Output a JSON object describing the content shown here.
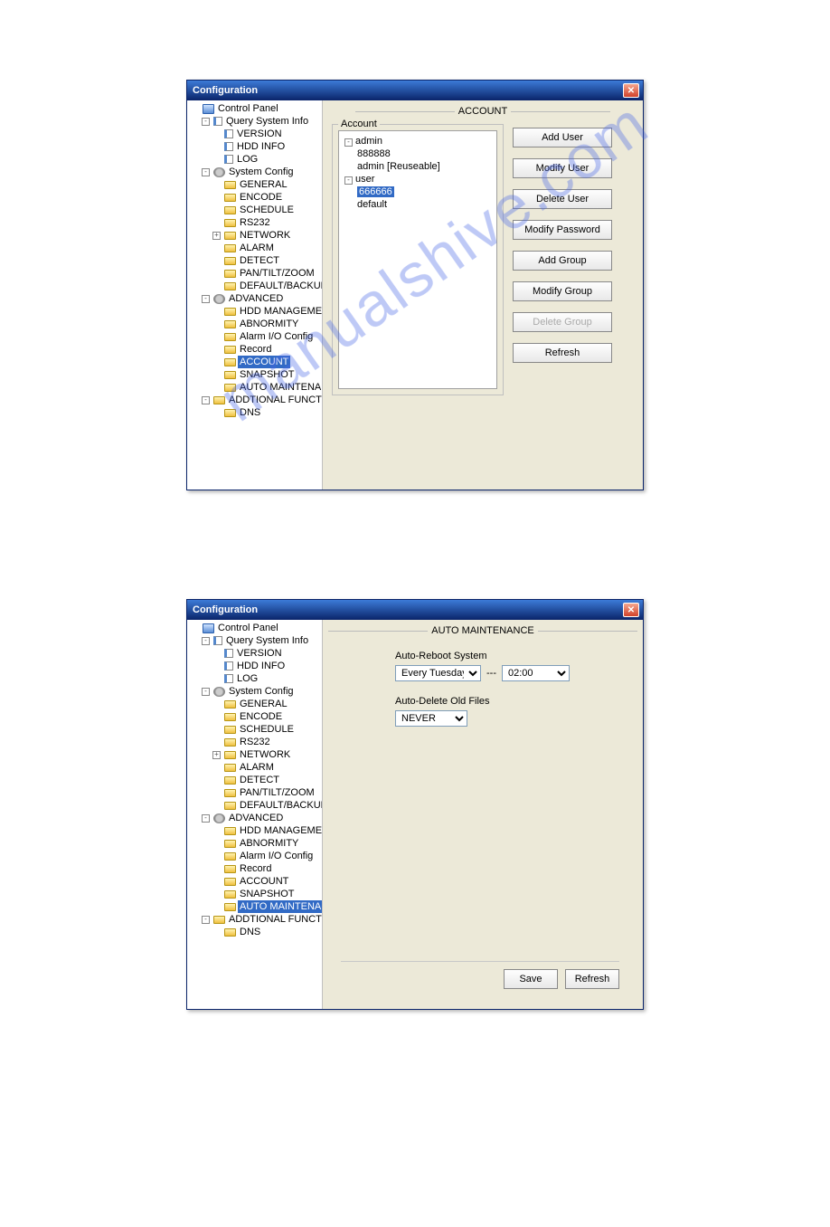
{
  "watermark": "manualshive.com",
  "win1": {
    "title": "Configuration",
    "panel_title": "ACCOUNT",
    "groupbox_legend": "Account",
    "tree": {
      "root": "Control Panel",
      "groups": [
        {
          "label": "Query System Info",
          "exp": "-",
          "icon": "page",
          "children": [
            {
              "label": "VERSION",
              "icon": "page"
            },
            {
              "label": "HDD INFO",
              "icon": "page"
            },
            {
              "label": "LOG",
              "icon": "page"
            }
          ]
        },
        {
          "label": "System Config",
          "exp": "-",
          "icon": "gear",
          "children": [
            {
              "label": "GENERAL",
              "icon": "folder"
            },
            {
              "label": "ENCODE",
              "icon": "folder"
            },
            {
              "label": "SCHEDULE",
              "icon": "folder"
            },
            {
              "label": "RS232",
              "icon": "folder"
            },
            {
              "label": "NETWORK",
              "icon": "folder",
              "exp": "+"
            },
            {
              "label": "ALARM",
              "icon": "folder"
            },
            {
              "label": "DETECT",
              "icon": "folder"
            },
            {
              "label": "PAN/TILT/ZOOM",
              "icon": "folder"
            },
            {
              "label": "DEFAULT/BACKUP",
              "icon": "folder"
            }
          ]
        },
        {
          "label": "ADVANCED",
          "exp": "-",
          "icon": "gear",
          "children": [
            {
              "label": "HDD MANAGEMENT",
              "icon": "folder"
            },
            {
              "label": "ABNORMITY",
              "icon": "folder"
            },
            {
              "label": "Alarm I/O Config",
              "icon": "folder"
            },
            {
              "label": "Record",
              "icon": "folder"
            },
            {
              "label": "ACCOUNT",
              "icon": "folder",
              "selected": true
            },
            {
              "label": "SNAPSHOT",
              "icon": "folder"
            },
            {
              "label": "AUTO MAINTENANCE",
              "icon": "folder"
            }
          ]
        },
        {
          "label": "ADDTIONAL FUNCTION",
          "exp": "-",
          "icon": "folder",
          "children": [
            {
              "label": "DNS",
              "icon": "folder"
            }
          ]
        }
      ]
    },
    "acct_tree": [
      {
        "label": "admin",
        "exp": "-",
        "children": [
          {
            "label": "888888"
          },
          {
            "label": "admin [Reuseable]"
          }
        ]
      },
      {
        "label": "user",
        "exp": "-",
        "children": [
          {
            "label": "666666",
            "selected": true
          },
          {
            "label": "default"
          }
        ]
      }
    ],
    "buttons": {
      "add_user": "Add User",
      "modify_user": "Modify User",
      "delete_user": "Delete User",
      "modify_password": "Modify Password",
      "add_group": "Add Group",
      "modify_group": "Modify Group",
      "delete_group": "Delete Group",
      "refresh": "Refresh"
    }
  },
  "win2": {
    "title": "Configuration",
    "panel_title": "AUTO MAINTENANCE",
    "tree_selected": "AUTO MAINTENANCE",
    "auto_reboot": {
      "label": "Auto-Reboot System",
      "day": "Every Tuesday",
      "sep": "---",
      "time": "02:00"
    },
    "auto_delete": {
      "label": "Auto-Delete Old Files",
      "value": "NEVER"
    },
    "footer": {
      "save": "Save",
      "refresh": "Refresh"
    }
  }
}
